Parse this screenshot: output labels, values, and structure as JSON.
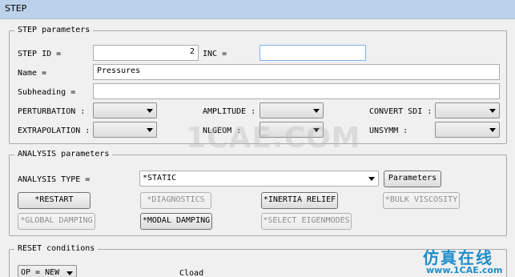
{
  "window": {
    "title": "STEP"
  },
  "step_params": {
    "legend": "STEP parameters",
    "step_id_label": "STEP ID =",
    "step_id_value": "2",
    "inc_label": "INC =",
    "inc_value": "",
    "name_label": "Name =",
    "name_value": "Pressures",
    "subheading_label": "Subheading =",
    "subheading_value": "",
    "perturbation_label": "PERTURBATION :",
    "perturbation_value": "",
    "amplitude_label": "AMPLITUDE :",
    "amplitude_value": "",
    "convert_sdi_label": "CONVERT SDI :",
    "convert_sdi_value": "",
    "extrapolation_label": "EXTRAPOLATION :",
    "extrapolation_value": "",
    "nlgeom_label": "NLGEOM :",
    "nlgeom_value": "",
    "unsymm_label": "UNSYMM :",
    "unsymm_value": ""
  },
  "analysis_params": {
    "legend": "ANALYSIS parameters",
    "analysis_type_label": "ANALYSIS TYPE =",
    "analysis_type_value": "*STATIC",
    "parameters_button": "Parameters",
    "restart": "*RESTART",
    "diagnostics": "*DIAGNOSTICS",
    "inertia_relief": "*INERTIA RELIEF",
    "bulk_viscosity": "*BULK VISCOSITY",
    "global_damping": "*GLOBAL DAMPING",
    "modal_damping": "*MODAL DAMPING",
    "select_eigenmodes": "*SELECT EIGENMODES"
  },
  "reset_conditions": {
    "legend": "RESET conditions",
    "op_value": "OP = NEW",
    "cload_label": "Cload"
  },
  "watermarks": {
    "center": "1CAE.COM",
    "cn_text": "仿真在线",
    "site": "www.1CAE.com"
  }
}
